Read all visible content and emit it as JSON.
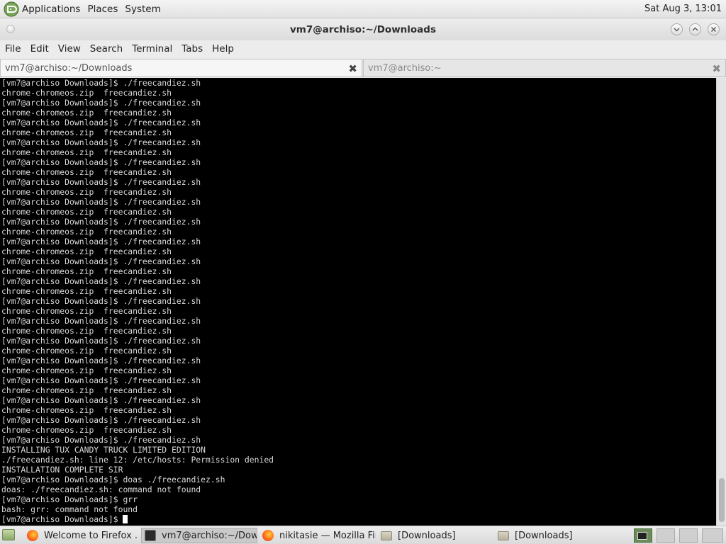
{
  "top_panel": {
    "menus": [
      "Applications",
      "Places",
      "System"
    ],
    "clock": "Sat Aug  3, 13:01"
  },
  "window": {
    "title": "vm7@archiso:~/Downloads",
    "buttons": [
      "minimize",
      "maximize",
      "close"
    ]
  },
  "menubar": [
    "File",
    "Edit",
    "View",
    "Search",
    "Terminal",
    "Tabs",
    "Help"
  ],
  "tabs": [
    {
      "label": "vm7@archiso:~/Downloads",
      "active": true
    },
    {
      "label": "vm7@archiso:~",
      "active": false
    }
  ],
  "terminal": {
    "lines": [
      "[vm7@archiso Downloads]$ ./freecandiez.sh",
      "chrome-chromeos.zip  freecandiez.sh",
      "[vm7@archiso Downloads]$ ./freecandiez.sh",
      "chrome-chromeos.zip  freecandiez.sh",
      "[vm7@archiso Downloads]$ ./freecandiez.sh",
      "chrome-chromeos.zip  freecandiez.sh",
      "[vm7@archiso Downloads]$ ./freecandiez.sh",
      "chrome-chromeos.zip  freecandiez.sh",
      "[vm7@archiso Downloads]$ ./freecandiez.sh",
      "chrome-chromeos.zip  freecandiez.sh",
      "[vm7@archiso Downloads]$ ./freecandiez.sh",
      "chrome-chromeos.zip  freecandiez.sh",
      "[vm7@archiso Downloads]$ ./freecandiez.sh",
      "chrome-chromeos.zip  freecandiez.sh",
      "[vm7@archiso Downloads]$ ./freecandiez.sh",
      "chrome-chromeos.zip  freecandiez.sh",
      "[vm7@archiso Downloads]$ ./freecandiez.sh",
      "chrome-chromeos.zip  freecandiez.sh",
      "[vm7@archiso Downloads]$ ./freecandiez.sh",
      "chrome-chromeos.zip  freecandiez.sh",
      "[vm7@archiso Downloads]$ ./freecandiez.sh",
      "chrome-chromeos.zip  freecandiez.sh",
      "[vm7@archiso Downloads]$ ./freecandiez.sh",
      "chrome-chromeos.zip  freecandiez.sh",
      "[vm7@archiso Downloads]$ ./freecandiez.sh",
      "chrome-chromeos.zip  freecandiez.sh",
      "[vm7@archiso Downloads]$ ./freecandiez.sh",
      "chrome-chromeos.zip  freecandiez.sh",
      "[vm7@archiso Downloads]$ ./freecandiez.sh",
      "chrome-chromeos.zip  freecandiez.sh",
      "[vm7@archiso Downloads]$ ./freecandiez.sh",
      "chrome-chromeos.zip  freecandiez.sh",
      "[vm7@archiso Downloads]$ ./freecandiez.sh",
      "chrome-chromeos.zip  freecandiez.sh",
      "[vm7@archiso Downloads]$ ./freecandiez.sh",
      "chrome-chromeos.zip  freecandiez.sh",
      "[vm7@archiso Downloads]$ ./freecandiez.sh",
      "INSTALLING TUX CANDY TRUCK LIMITED EDITION",
      "./freecandiez.sh: line 12: /etc/hosts: Permission denied",
      "INSTALLATION COMPLETE SIR",
      "[vm7@archiso Downloads]$ doas ./freecandiez.sh",
      "doas: ./freecandiez.sh: command not found",
      "[vm7@archiso Downloads]$ grr",
      "bash: grr: command not found"
    ],
    "prompt": "[vm7@archiso Downloads]$ "
  },
  "taskbar": {
    "tasks": [
      {
        "label": "Welcome to Firefox ...",
        "icon": "firefox-icon",
        "active": false
      },
      {
        "label": "vm7@archiso:~/Dow...",
        "icon": "terminal-icon",
        "active": true
      },
      {
        "label": "nikitasie — Mozilla Fir...",
        "icon": "firefox-icon",
        "active": false
      },
      {
        "label": "[Downloads]",
        "icon": "folder-icon",
        "active": false
      },
      {
        "label": "[Downloads]",
        "icon": "folder-icon",
        "active": false
      }
    ]
  },
  "colors": {
    "terminal_bg": "#000000",
    "terminal_fg": "#d9d9d9",
    "panel_bg": "#e6e6e6",
    "workspace_active": "#6b8c5a"
  }
}
